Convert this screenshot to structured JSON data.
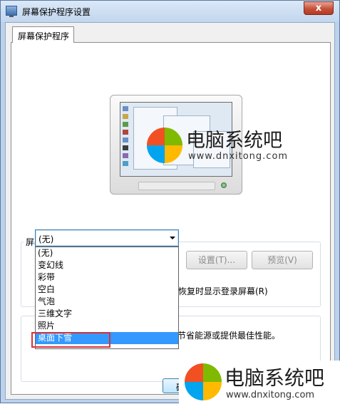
{
  "window": {
    "title": "屏幕保护程序设置",
    "close_glyph": "x"
  },
  "tab": {
    "label": "屏幕保护程序"
  },
  "screensaver": {
    "group_label": "屏幕保护程序(S)",
    "selected": "(无)",
    "settings_button": "设置(T)...",
    "preview_button": "预览(V)",
    "resume_text_partial": "恢复时显示登录屏幕(R)",
    "options": [
      "(无)",
      "变幻线",
      "彩带",
      "空白",
      "气泡",
      "三维文字",
      "照片",
      "桌面下雪"
    ],
    "highlighted_option": "桌面下雪"
  },
  "power": {
    "text_partial": "节省能源或提供最佳性能。"
  },
  "footer": {
    "ok_partial": "确"
  },
  "watermarks": {
    "name": "电脑系统吧",
    "url": "www.dnxitong.com",
    "logo_colors": [
      "#f25022",
      "#7fba00",
      "#00a4ef",
      "#ffb900"
    ]
  }
}
